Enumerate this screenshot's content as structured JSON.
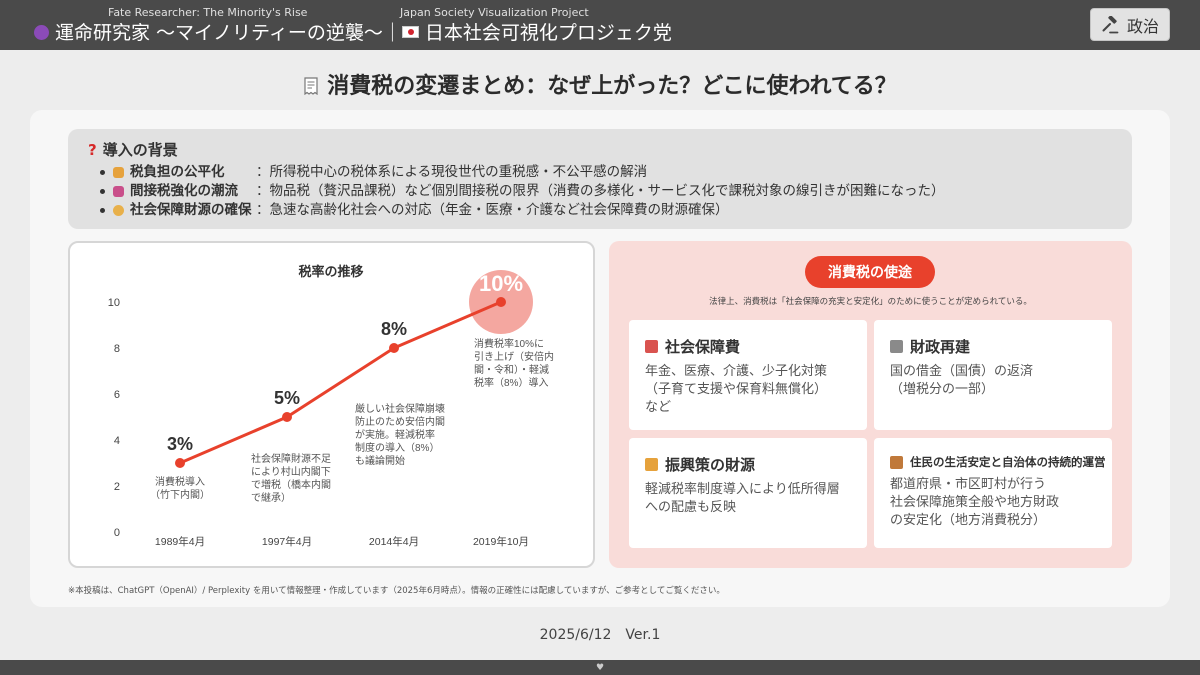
{
  "header": {
    "left_subtitle": "Fate Researcher: The Minority's Rise",
    "left_title": "運命研究家 〜マイノリティーの逆襲〜｜",
    "right_subtitle": "Japan Society Visualization Project",
    "right_title": "日本社会可視化プロジェク党",
    "button_label": "政治",
    "colors": {
      "bar": "#4a4a4a",
      "accent": "#e8412c",
      "icon_crystal": "#8b4bb8",
      "icon_flag": "#d2242f"
    }
  },
  "page_title": "消費税の変遷まとめ：なぜ上がった？どこに使われてる？",
  "background_box": {
    "heading": "導入の背景",
    "items": [
      {
        "label": "税負担の公平化",
        "desc": "：所得税中心の税体系による現役世代の重税感・不公平感の解消"
      },
      {
        "label": "間接税強化の潮流",
        "desc": "：物品税（贅沢品課税）など個別間接税の限界（消費の多様化・サービス化で課税対象の線引きが困難になった）"
      },
      {
        "label": "社会保障財源の確保",
        "desc": "：急速な高齢化社会への対応（年金・医療・介護など社会保障費の財源確保）"
      }
    ]
  },
  "chart_data": {
    "type": "line",
    "title": "税率の推移",
    "categories": [
      "1989年4月",
      "1997年4月",
      "2014年4月",
      "2019年10月"
    ],
    "values": [
      3,
      5,
      8,
      10
    ],
    "data_labels": [
      "3%",
      "5%",
      "8%",
      "10%"
    ],
    "ylim": [
      0,
      10
    ],
    "yticks": [
      0,
      2,
      4,
      6,
      8,
      10
    ],
    "grid": false,
    "line_color": "#e8412c",
    "annotations": [
      [
        "消費税導入",
        "（竹下内閣）"
      ],
      [
        "社会保障財源不足",
        "により村山内閣下",
        "で増税（橋本内閣",
        "で継承）"
      ],
      [
        "厳しい社会保障崩壊",
        "防止のため安倍内閣",
        "が実施。軽減税率",
        "制度の導入（8%）",
        "も議論開始"
      ],
      [
        "消費税率10%に",
        "引き上げ（安倍内",
        "閣・令和）・軽減",
        "税率（8%）導入"
      ]
    ]
  },
  "uses": {
    "heading": "消費税の使途",
    "note": "法律上、消費税は「社会保障の充実と安定化」のために使うことが定められている。",
    "cards": [
      {
        "title": "社会保障費",
        "desc": "年金、医療、介護、少子化対策\n（子育て支援や保育料無償化）\nなど",
        "icon": "hospital-icon"
      },
      {
        "title": "財政再建",
        "desc": "国の借金（国債）の返済\n（増税分の一部）",
        "icon": "bank-icon"
      },
      {
        "title": "振興策の財源",
        "desc": "軽減税率制度導入により低所得層\nへの配慮も反映",
        "icon": "people-icon"
      },
      {
        "title": "住民の生活安定と自治体の持続的運営",
        "desc": "都道府県・市区町村が行う\n社会保障施策全般や地方財政\nの安定化（地方消費税分）",
        "icon": "family-icon"
      }
    ]
  },
  "footnote": "※本投稿は、ChatGPT（OpenAI）/ Perplexity を用いて情報整理・作成しています（2025年6月時点）。情報の正確性には配慮していますが、ご参考としてご覧ください。",
  "date_version": "2025/6/12　Ver.1"
}
